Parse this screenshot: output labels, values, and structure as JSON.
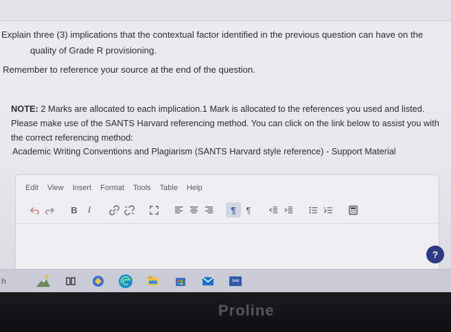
{
  "question": {
    "line1": "Explain three (3) implications that the contextual factor identified in the previous question can have on the",
    "line2": "quality of Grade R provisioning.",
    "reference": "Remember to reference your source at the end of the question."
  },
  "note": {
    "label": "NOTE:",
    "text": " 2 Marks are allocated to each implication.1 Mark is allocated to the references you used and listed. Please make use of the SANTS Harvard referencing method. You can click on the link below to assist you with the correct referencing method:"
  },
  "link": "Academic Writing Conventions and Plagiarism (SANTS Harvard style reference) - Support Material",
  "editor": {
    "menu": [
      "Edit",
      "View",
      "Insert",
      "Format",
      "Tools",
      "Table",
      "Help"
    ],
    "toolbar": {
      "bold": "B",
      "italic": "I",
      "ltr": "¶",
      "rtl": "¶"
    }
  },
  "help_label": "?",
  "taskbar": {
    "left_char": "h",
    "badge": "SAM"
  },
  "brand": "Proline"
}
